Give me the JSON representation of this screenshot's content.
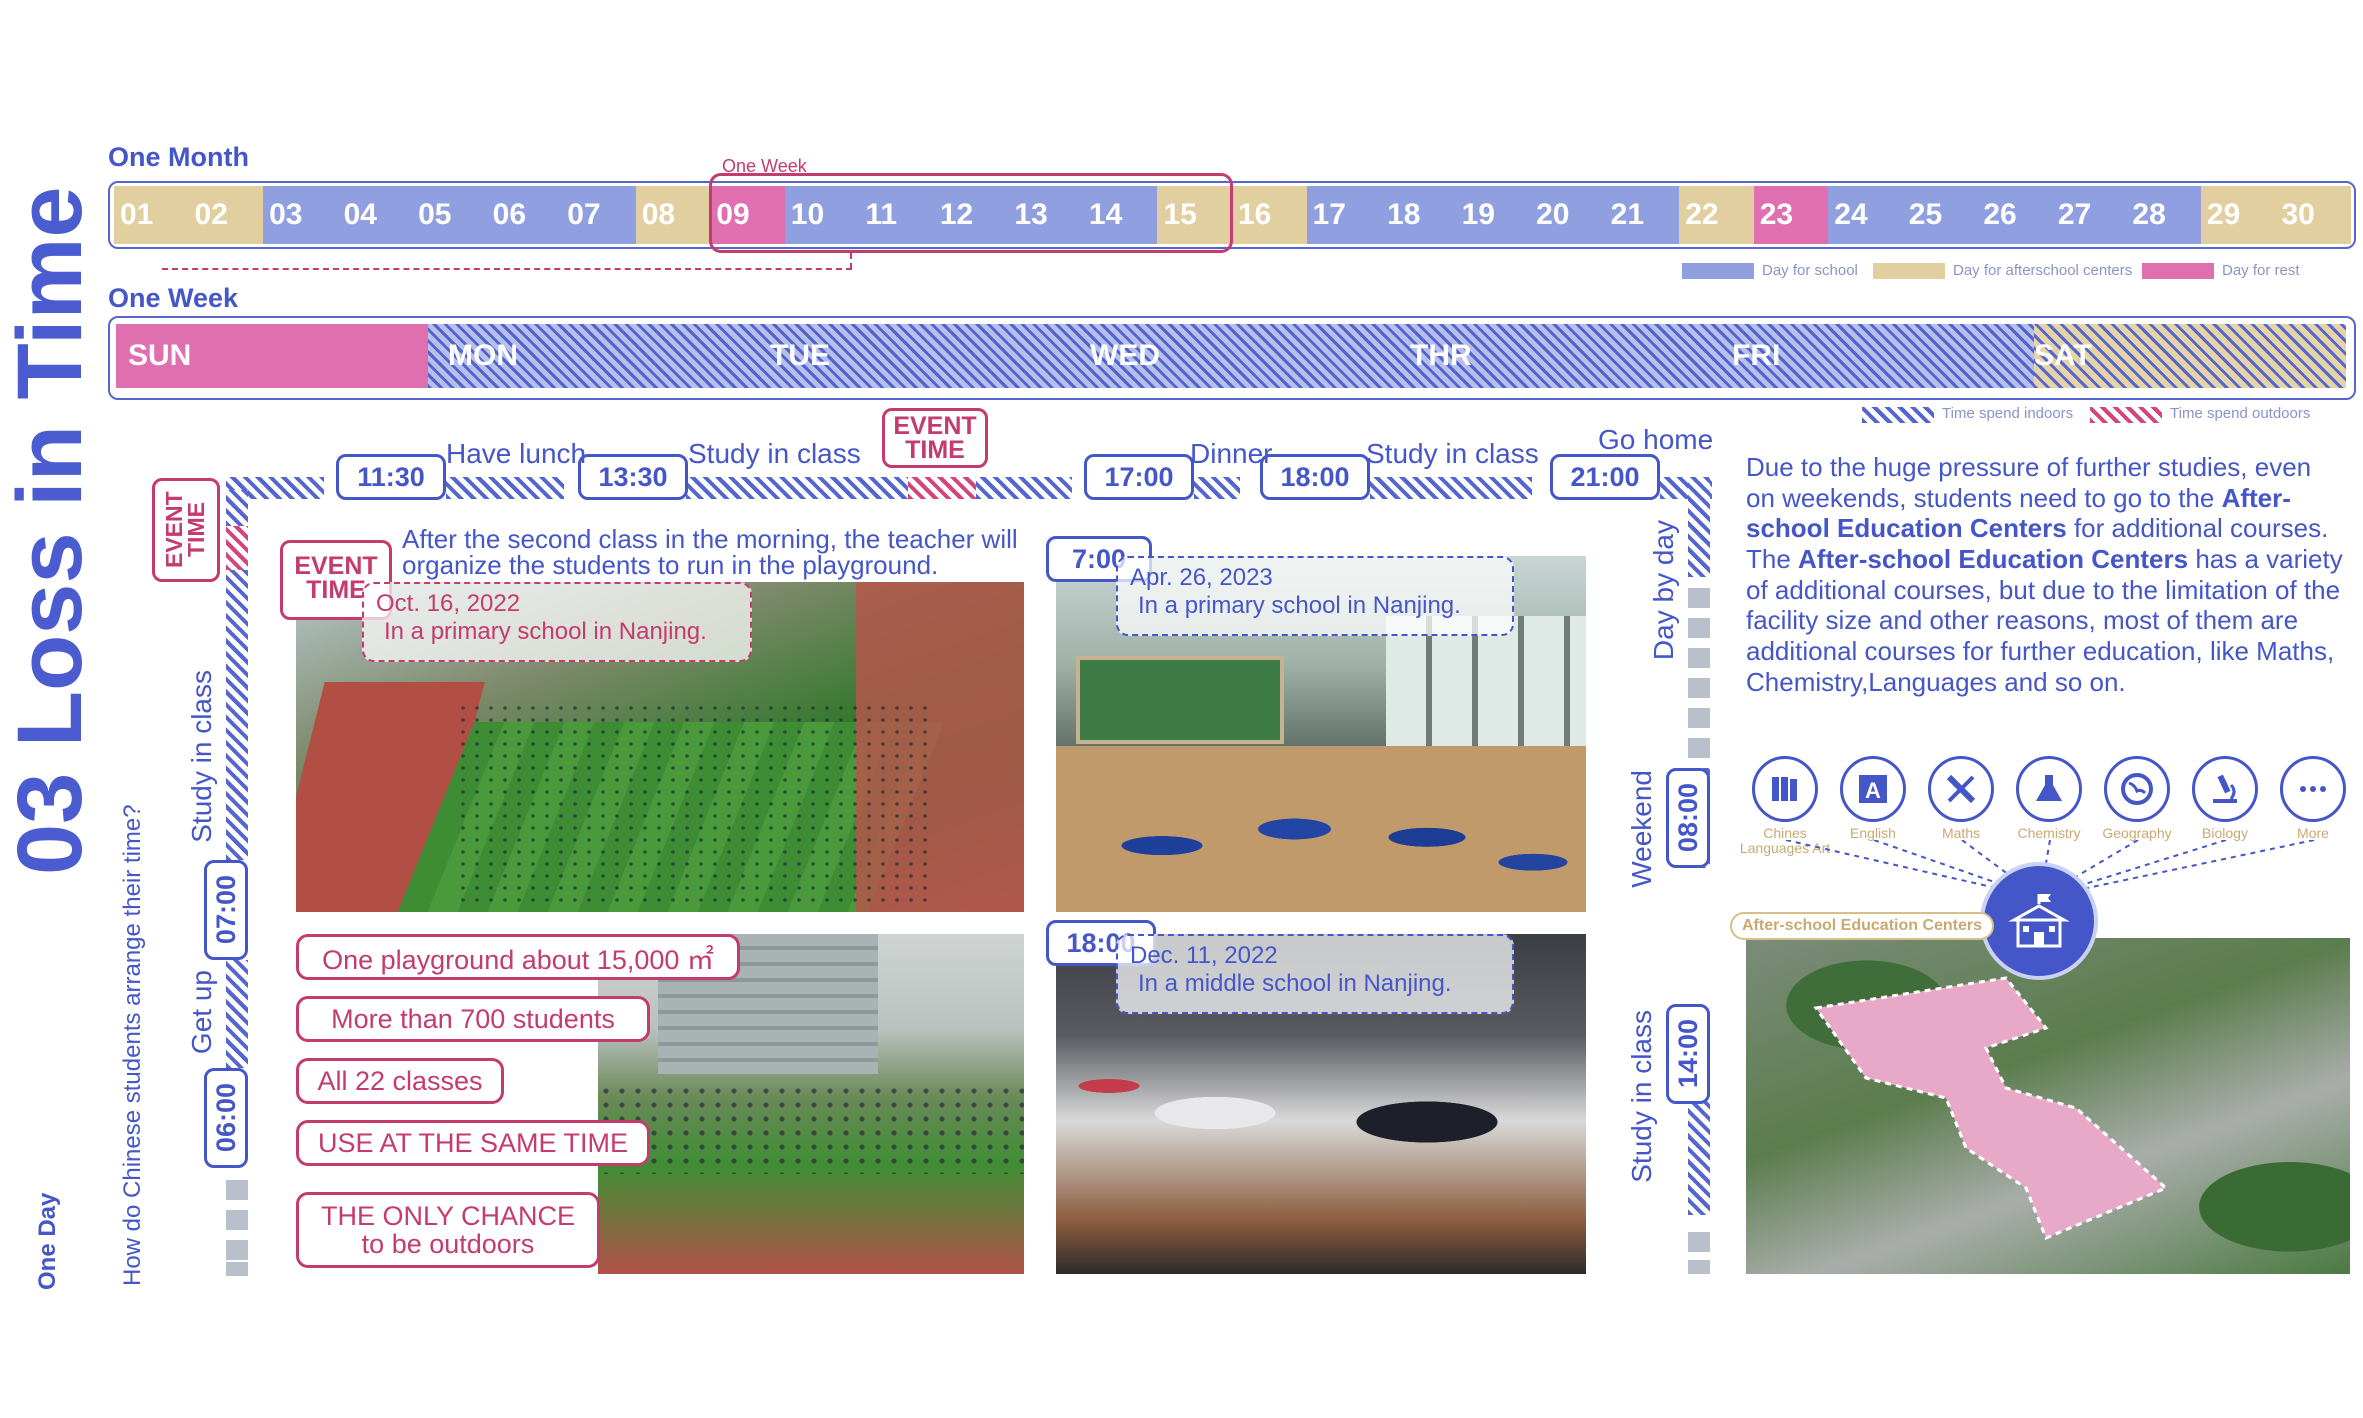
{
  "title": "03 Loss in Time",
  "one_day": {
    "label": "One Day",
    "question": "How do Chinese students arrange their time?"
  },
  "month": {
    "label": "One Month",
    "week_marker": "One Week",
    "days": [
      {
        "d": "01",
        "t": "aft"
      },
      {
        "d": "02",
        "t": "aft"
      },
      {
        "d": "03",
        "t": "sch"
      },
      {
        "d": "04",
        "t": "sch"
      },
      {
        "d": "05",
        "t": "sch"
      },
      {
        "d": "06",
        "t": "sch"
      },
      {
        "d": "07",
        "t": "sch"
      },
      {
        "d": "08",
        "t": "aft"
      },
      {
        "d": "09",
        "t": "rst"
      },
      {
        "d": "10",
        "t": "sch"
      },
      {
        "d": "11",
        "t": "sch"
      },
      {
        "d": "12",
        "t": "sch"
      },
      {
        "d": "13",
        "t": "sch"
      },
      {
        "d": "14",
        "t": "sch"
      },
      {
        "d": "15",
        "t": "aft"
      },
      {
        "d": "16",
        "t": "aft"
      },
      {
        "d": "17",
        "t": "sch"
      },
      {
        "d": "18",
        "t": "sch"
      },
      {
        "d": "19",
        "t": "sch"
      },
      {
        "d": "20",
        "t": "sch"
      },
      {
        "d": "21",
        "t": "sch"
      },
      {
        "d": "22",
        "t": "aft"
      },
      {
        "d": "23",
        "t": "rst"
      },
      {
        "d": "24",
        "t": "sch"
      },
      {
        "d": "25",
        "t": "sch"
      },
      {
        "d": "26",
        "t": "sch"
      },
      {
        "d": "27",
        "t": "sch"
      },
      {
        "d": "28",
        "t": "sch"
      },
      {
        "d": "29",
        "t": "aft"
      },
      {
        "d": "30",
        "t": "aft"
      }
    ],
    "legend": [
      "Day for school",
      "Day for afterschool centers",
      "Day for rest"
    ],
    "colors": {
      "school": "#8f9fe0",
      "after": "#e2cf9f",
      "rest": "#df6fae",
      "accent_blue": "#4456c8",
      "accent_pink": "#c43b6f"
    }
  },
  "week": {
    "label": "One Week",
    "days": [
      "SUN",
      "MON",
      "TUE",
      "WED",
      "THR",
      "FRI",
      "SAT"
    ],
    "legend": [
      "Time spend indoors",
      "Time spend outdoors"
    ]
  },
  "schedule": {
    "top_times": [
      "11:30",
      "13:30",
      "17:00",
      "18:00",
      "21:00"
    ],
    "top_labels": [
      "Have lunch",
      "Study in class",
      "Dinner",
      "Study in class",
      "Go home"
    ],
    "event_time": "EVENT TIME",
    "left_times": [
      "06:00",
      "07:00"
    ],
    "left_labels": [
      "Get up",
      "Study in class"
    ],
    "right_times": [
      "08:00",
      "14:00"
    ],
    "right_labels": [
      "Day by day",
      "Weekend",
      "Study in class"
    ]
  },
  "photos": {
    "playground_note": "After the second class in the morning, the teacher will organize the students to run in the playground.",
    "p1_time": "EVENT TIME",
    "p1_date": "Oct. 16, 2022",
    "p1_place": "In a primary school in Nanjing.",
    "p2_time": "7:00",
    "p2_date": "Apr. 26, 2023",
    "p2_place": "In a primary school in Nanjing.",
    "p3_time": "18:00",
    "p3_date": "Dec. 11, 2022",
    "p3_place": "In a middle school in Nanjing."
  },
  "facts": [
    "One playground about 15,000 ㎡",
    "More than 700 students",
    "All 22 classes",
    "USE AT THE SAME TIME",
    "THE ONLY CHANCE to be outdoors"
  ],
  "text": {
    "p1_a": "Due to the huge pressure of further studies, even on weekends, students need to go to the ",
    "p1_b": "After-school Education Centers",
    "p1_c": " for additional courses.",
    "p2_a": "The ",
    "p2_b": "After-school Education Centers",
    "p2_c": " has a variety of additional courses, but due to the limitation of the facility size and other reasons, most of them are additional courses for further education, like Maths, Chemistry,Languages and so on."
  },
  "courses": [
    {
      "label": "Chines Languages Art",
      "icon": "books-icon"
    },
    {
      "label": "English",
      "icon": "letter-a-icon"
    },
    {
      "label": "Maths",
      "icon": "ruler-pencil-icon"
    },
    {
      "label": "Chemistry",
      "icon": "flask-icon"
    },
    {
      "label": "Geography",
      "icon": "globe-icon"
    },
    {
      "label": "Biology",
      "icon": "microscope-icon"
    },
    {
      "label": "More",
      "icon": "more-dots-icon"
    }
  ],
  "center_label": "After-school Education Centers"
}
